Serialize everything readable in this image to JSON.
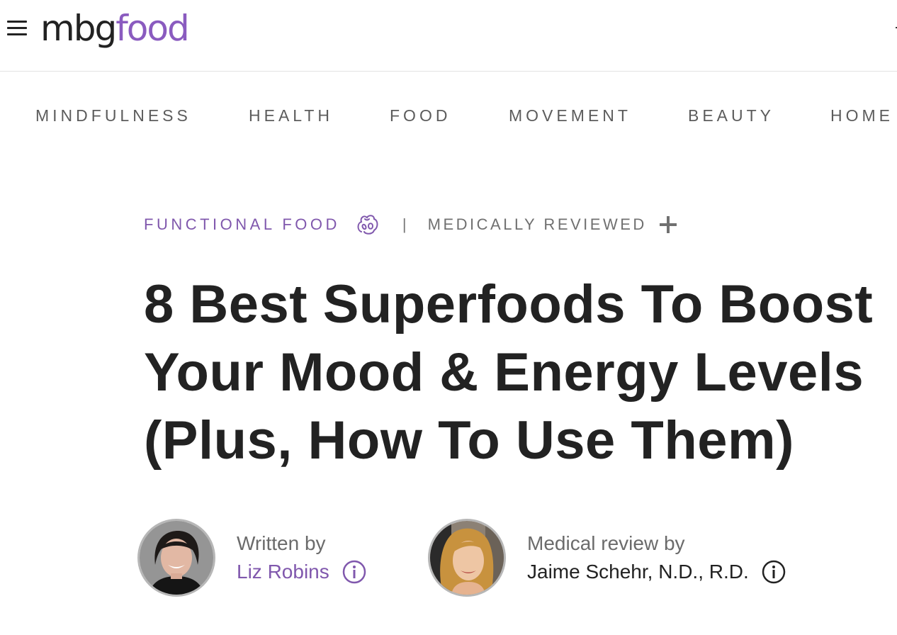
{
  "header": {
    "logo": {
      "part1": "mbg",
      "part2": "food"
    },
    "menu_icon": "hamburger-menu-icon"
  },
  "nav": {
    "items": [
      {
        "label": "MINDFULNESS"
      },
      {
        "label": "HEALTH"
      },
      {
        "label": "FOOD"
      },
      {
        "label": "MOVEMENT"
      },
      {
        "label": "BEAUTY"
      },
      {
        "label": "HOME"
      }
    ]
  },
  "article": {
    "category": "FUNCTIONAL FOOD",
    "category_icon": "functional-food-icon",
    "separator": "|",
    "review_status": "MEDICALLY REVIEWED",
    "review_icon": "plus-icon",
    "title_lines": [
      "8 Best Superfoods To Boost",
      "Your Mood & Energy Levels",
      "(Plus, How To Use Them)"
    ],
    "author": {
      "label": "Written by",
      "name": "Liz Robins",
      "icon": "info-icon"
    },
    "reviewer": {
      "label": "Medical review by",
      "name": "Jaime Schehr, N.D., R.D.",
      "icon": "info-icon"
    }
  },
  "colors": {
    "brand_purple": "#8058ad",
    "text_dark": "#222222",
    "text_gray": "#6b6b6b",
    "divider": "#e3e3e3"
  }
}
